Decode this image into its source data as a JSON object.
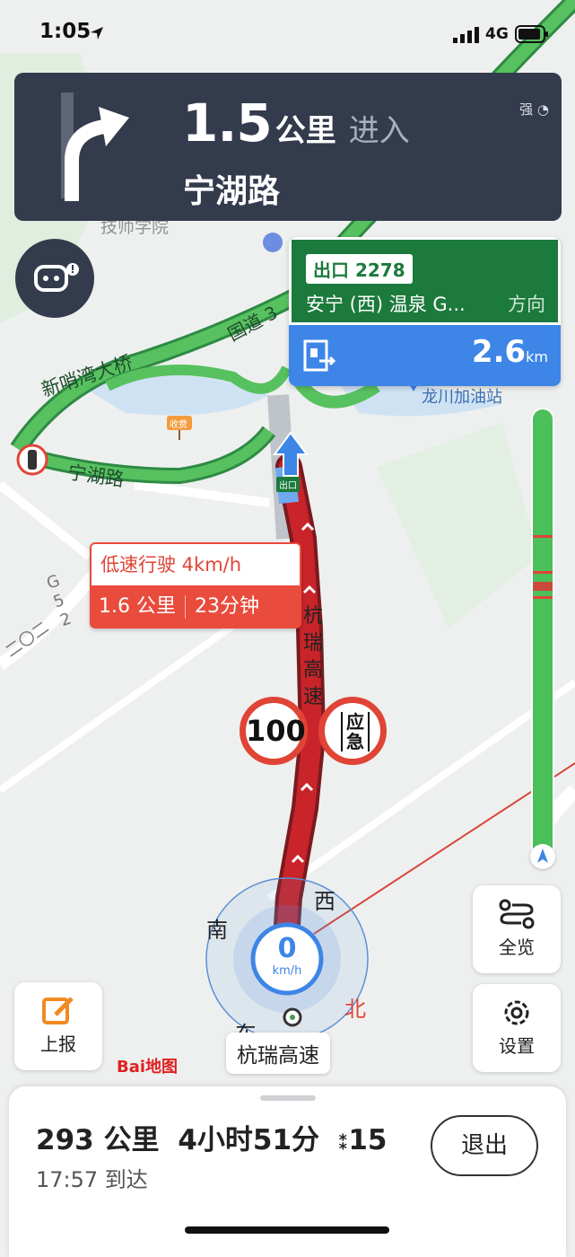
{
  "status_bar": {
    "time": "1:05",
    "network": "4G"
  },
  "nav_banner": {
    "distance_value": "1.5",
    "distance_unit": "公里",
    "action": "进入",
    "road": "宁湖路",
    "signal": "强"
  },
  "map_labels": {
    "xinshaowan_bridge": "新哨湾大桥",
    "guodao": "国道 3",
    "ninghu_road": "宁湖路",
    "toll": "收费",
    "exit_marker": "出口",
    "gas_station": "龙川加油站",
    "school": "技师学院",
    "hangrui_vertical": "杭瑞高速",
    "g_road_vertical": "G 5 2",
    "highway_left": "二〇二"
  },
  "exit_sign": {
    "tag": "出口 2278",
    "destination": "安宁 (西) 温泉 G...",
    "direction": "方向",
    "distance": "2.6",
    "distance_unit": "km"
  },
  "slow_notice": {
    "title": "低速行驶 4km/h",
    "distance": "1.6 公里",
    "duration": "23分钟"
  },
  "speed_limit": "100",
  "emergency_sign": "应急",
  "compass": {
    "south": "南",
    "west": "西",
    "north": "北",
    "east": "东"
  },
  "speed": {
    "value": "0",
    "unit": "km/h"
  },
  "buttons": {
    "overview": "全览",
    "settings": "设置",
    "report": "上报"
  },
  "current_road": "杭瑞高速",
  "brand": "Bai地图",
  "trip": {
    "distance": "293 公里",
    "time": "4小时51分",
    "lights": "15",
    "arrival": "17:57 到达",
    "exit_label": "退出"
  },
  "colors": {
    "banner": "#333b4c",
    "route_red": "#c8242a",
    "road_green": "#4bbf5a",
    "exit_green": "#1c7a3c",
    "exit_blue": "#3d85e6"
  }
}
